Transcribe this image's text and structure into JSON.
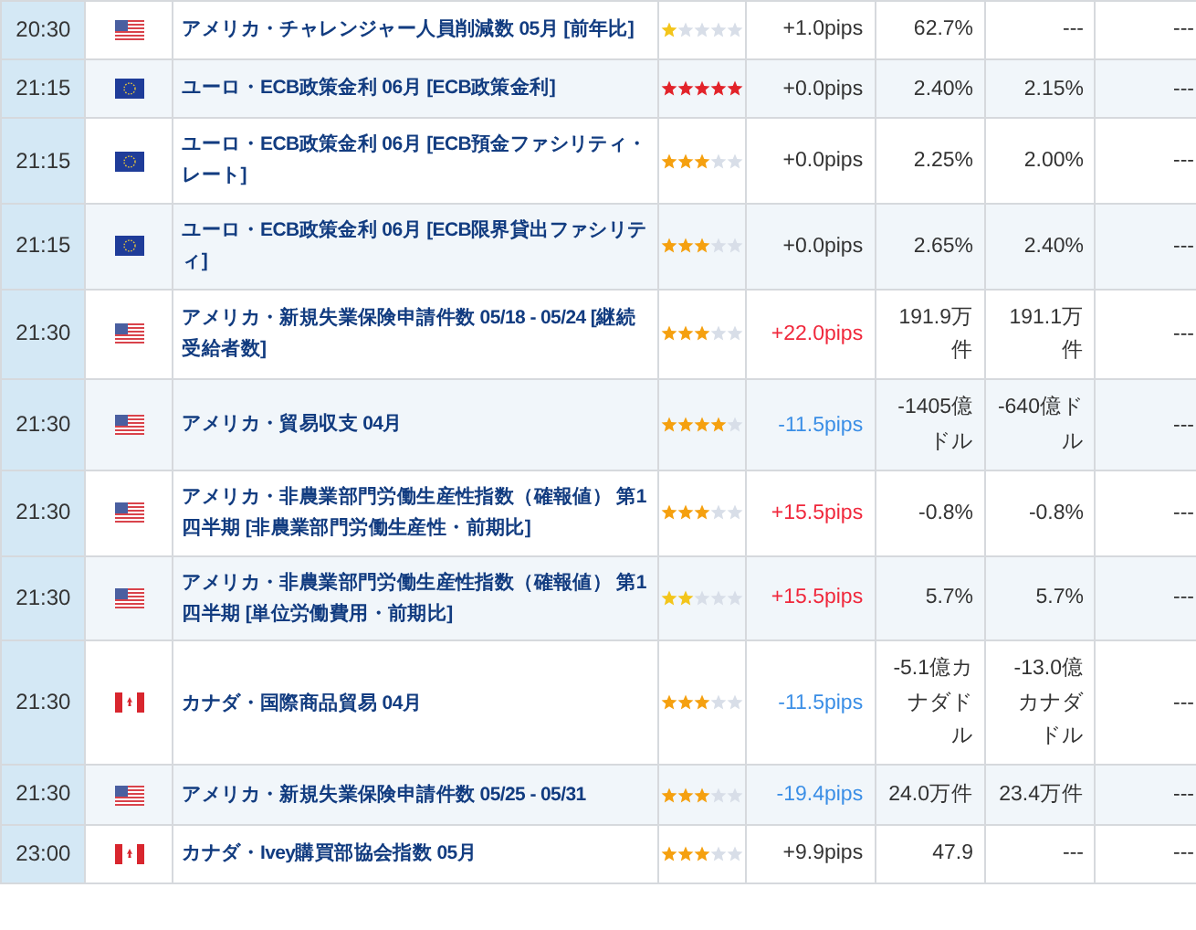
{
  "rows": [
    {
      "time": "20:30",
      "flag": {
        "kind": "us"
      },
      "event": "アメリカ・チャレンジャー人員削減数 05月 [前年比]",
      "stars": 1,
      "pips": {
        "text": "+1.0pips",
        "color": "#333333"
      },
      "column_6": "62.7%",
      "column_7": "---",
      "column_8": "---"
    },
    {
      "time": "21:15",
      "flag": {
        "kind": "eu"
      },
      "event": "ユーロ・ECB政策金利 06月 [ECB政策金利]",
      "stars": 5,
      "pips": {
        "text": "+0.0pips",
        "color": "#333333"
      },
      "column_6": "2.40%",
      "column_7": "2.15%",
      "column_8": "---"
    },
    {
      "time": "21:15",
      "flag": {
        "kind": "eu"
      },
      "event": "ユーロ・ECB政策金利 06月 [ECB預金ファシリティ・レート]",
      "stars": 3,
      "pips": {
        "text": "+0.0pips",
        "color": "#333333"
      },
      "column_6": "2.25%",
      "column_7": "2.00%",
      "column_8": "---"
    },
    {
      "time": "21:15",
      "flag": {
        "kind": "eu"
      },
      "event": "ユーロ・ECB政策金利 06月 [ECB限界貸出ファシリティ]",
      "stars": 3,
      "pips": {
        "text": "+0.0pips",
        "color": "#333333"
      },
      "column_6": "2.65%",
      "column_7": "2.40%",
      "column_8": "---"
    },
    {
      "time": "21:30",
      "flag": {
        "kind": "us"
      },
      "event": "アメリカ・新規失業保険申請件数 05/18 - 05/24 [継続受給者数]",
      "stars": 3,
      "pips": {
        "text": "+22.0pips",
        "color": "#f0283c"
      },
      "column_6": "191.9万件",
      "column_7": "191.1万件",
      "column_8": "---"
    },
    {
      "time": "21:30",
      "flag": {
        "kind": "us"
      },
      "event": "アメリカ・貿易収支 04月",
      "stars": 4,
      "pips": {
        "text": "-11.5pips",
        "color": "#3a8ee6"
      },
      "column_6": "-1405億ドル",
      "column_7": "-640億ドル",
      "column_8": "---"
    },
    {
      "time": "21:30",
      "flag": {
        "kind": "us"
      },
      "event": "アメリカ・非農業部門労働生産性指数（確報値） 第1四半期 [非農業部門労働生産性・前期比]",
      "stars": 3,
      "pips": {
        "text": "+15.5pips",
        "color": "#f0283c"
      },
      "column_6": "-0.8%",
      "column_7": "-0.8%",
      "column_8": "---"
    },
    {
      "time": "21:30",
      "flag": {
        "kind": "us"
      },
      "event": "アメリカ・非農業部門労働生産性指数（確報値） 第1四半期 [単位労働費用・前期比]",
      "stars": 2,
      "pips": {
        "text": "+15.5pips",
        "color": "#f0283c"
      },
      "column_6": "5.7%",
      "column_7": "5.7%",
      "column_8": "---"
    },
    {
      "time": "21:30",
      "flag": {
        "kind": "ca"
      },
      "event": "カナダ・国際商品貿易 04月",
      "stars": 3,
      "pips": {
        "text": "-11.5pips",
        "color": "#3a8ee6"
      },
      "column_6": "-5.1億カナダドル",
      "column_7": "-13.0億カナダドル",
      "column_8": "---"
    },
    {
      "time": "21:30",
      "flag": {
        "kind": "us"
      },
      "event": "アメリカ・新規失業保険申請件数 05/25 - 05/31",
      "stars": 3,
      "pips": {
        "text": "-19.4pips",
        "color": "#3a8ee6"
      },
      "column_6": "24.0万件",
      "column_7": "23.4万件",
      "column_8": "---"
    },
    {
      "time": "23:00",
      "flag": {
        "kind": "ca"
      },
      "event": "カナダ・Ivey購買部協会指数 05月",
      "stars": 3,
      "pips": {
        "text": "+9.9pips",
        "color": "#333333"
      },
      "column_6": "47.9",
      "column_7": "---",
      "column_8": "---"
    }
  ]
}
